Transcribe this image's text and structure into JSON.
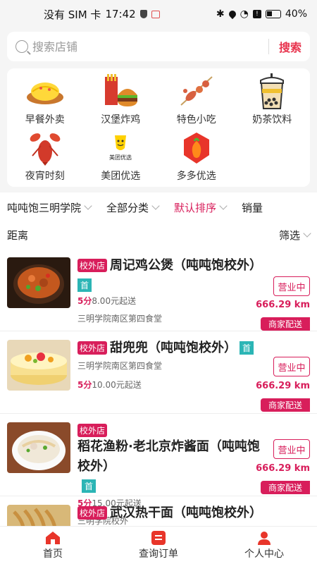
{
  "status_bar": {
    "sim": "没有 SIM 卡",
    "time": "17:42",
    "battery": "40%"
  },
  "search": {
    "placeholder": "搜索店铺",
    "button": "搜索"
  },
  "categories": [
    {
      "label": "早餐外卖",
      "icon": "omelette-icon"
    },
    {
      "label": "汉堡炸鸡",
      "icon": "burger-fries-icon"
    },
    {
      "label": "特色小吃",
      "icon": "skewer-icon"
    },
    {
      "label": "奶茶饮料",
      "icon": "bubble-tea-icon"
    },
    {
      "label": "夜宵时刻",
      "icon": "lobster-icon"
    },
    {
      "label": "美团优选",
      "icon": "meituan-youxuan-logo",
      "logo_text": "美团优选"
    },
    {
      "label": "多多优选",
      "icon": "duoduo-youxuan-logo"
    }
  ],
  "filters": {
    "location": "吨吨饱三明学院",
    "category": "全部分类",
    "sort": "默认排序",
    "sales": "销量",
    "distance": "距离",
    "screen": "筛选"
  },
  "shops": [
    {
      "tag": "校外店",
      "name": "周记鸡公煲（吨吨饱校外）",
      "first_tag": "首",
      "rating": "5分",
      "min_order": "8.00元起送",
      "address": "三明学院南区第四食堂",
      "status": "营业中",
      "distance": "666.29 km",
      "delivery": "商家配送"
    },
    {
      "tag": "校外店",
      "name": "甜兜兜（吨吨饱校外）",
      "first_tag": "首",
      "rating": "5分",
      "min_order": "10.00元起送",
      "address": "三明学院南区第四食堂",
      "status": "营业中",
      "distance": "666.29 km",
      "delivery": "商家配送"
    },
    {
      "tag": "校外店",
      "name": "稻花渔粉·老北京炸酱面（吨吨饱校外）",
      "first_tag": "首",
      "rating": "5分",
      "min_order": "15.00元起送",
      "address": "三明学院校外",
      "status": "营业中",
      "distance": "666.29 km",
      "delivery": "商家配送"
    },
    {
      "tag": "校外店",
      "name": "武汉热干面（吨吨饱校外）"
    }
  ],
  "tabs": [
    {
      "label": "首页"
    },
    {
      "label": "查询订单"
    },
    {
      "label": "个人中心"
    }
  ],
  "colors": {
    "accent": "#d81e5b",
    "search_red": "#e8344e",
    "first_tag": "#2bb5b5"
  }
}
